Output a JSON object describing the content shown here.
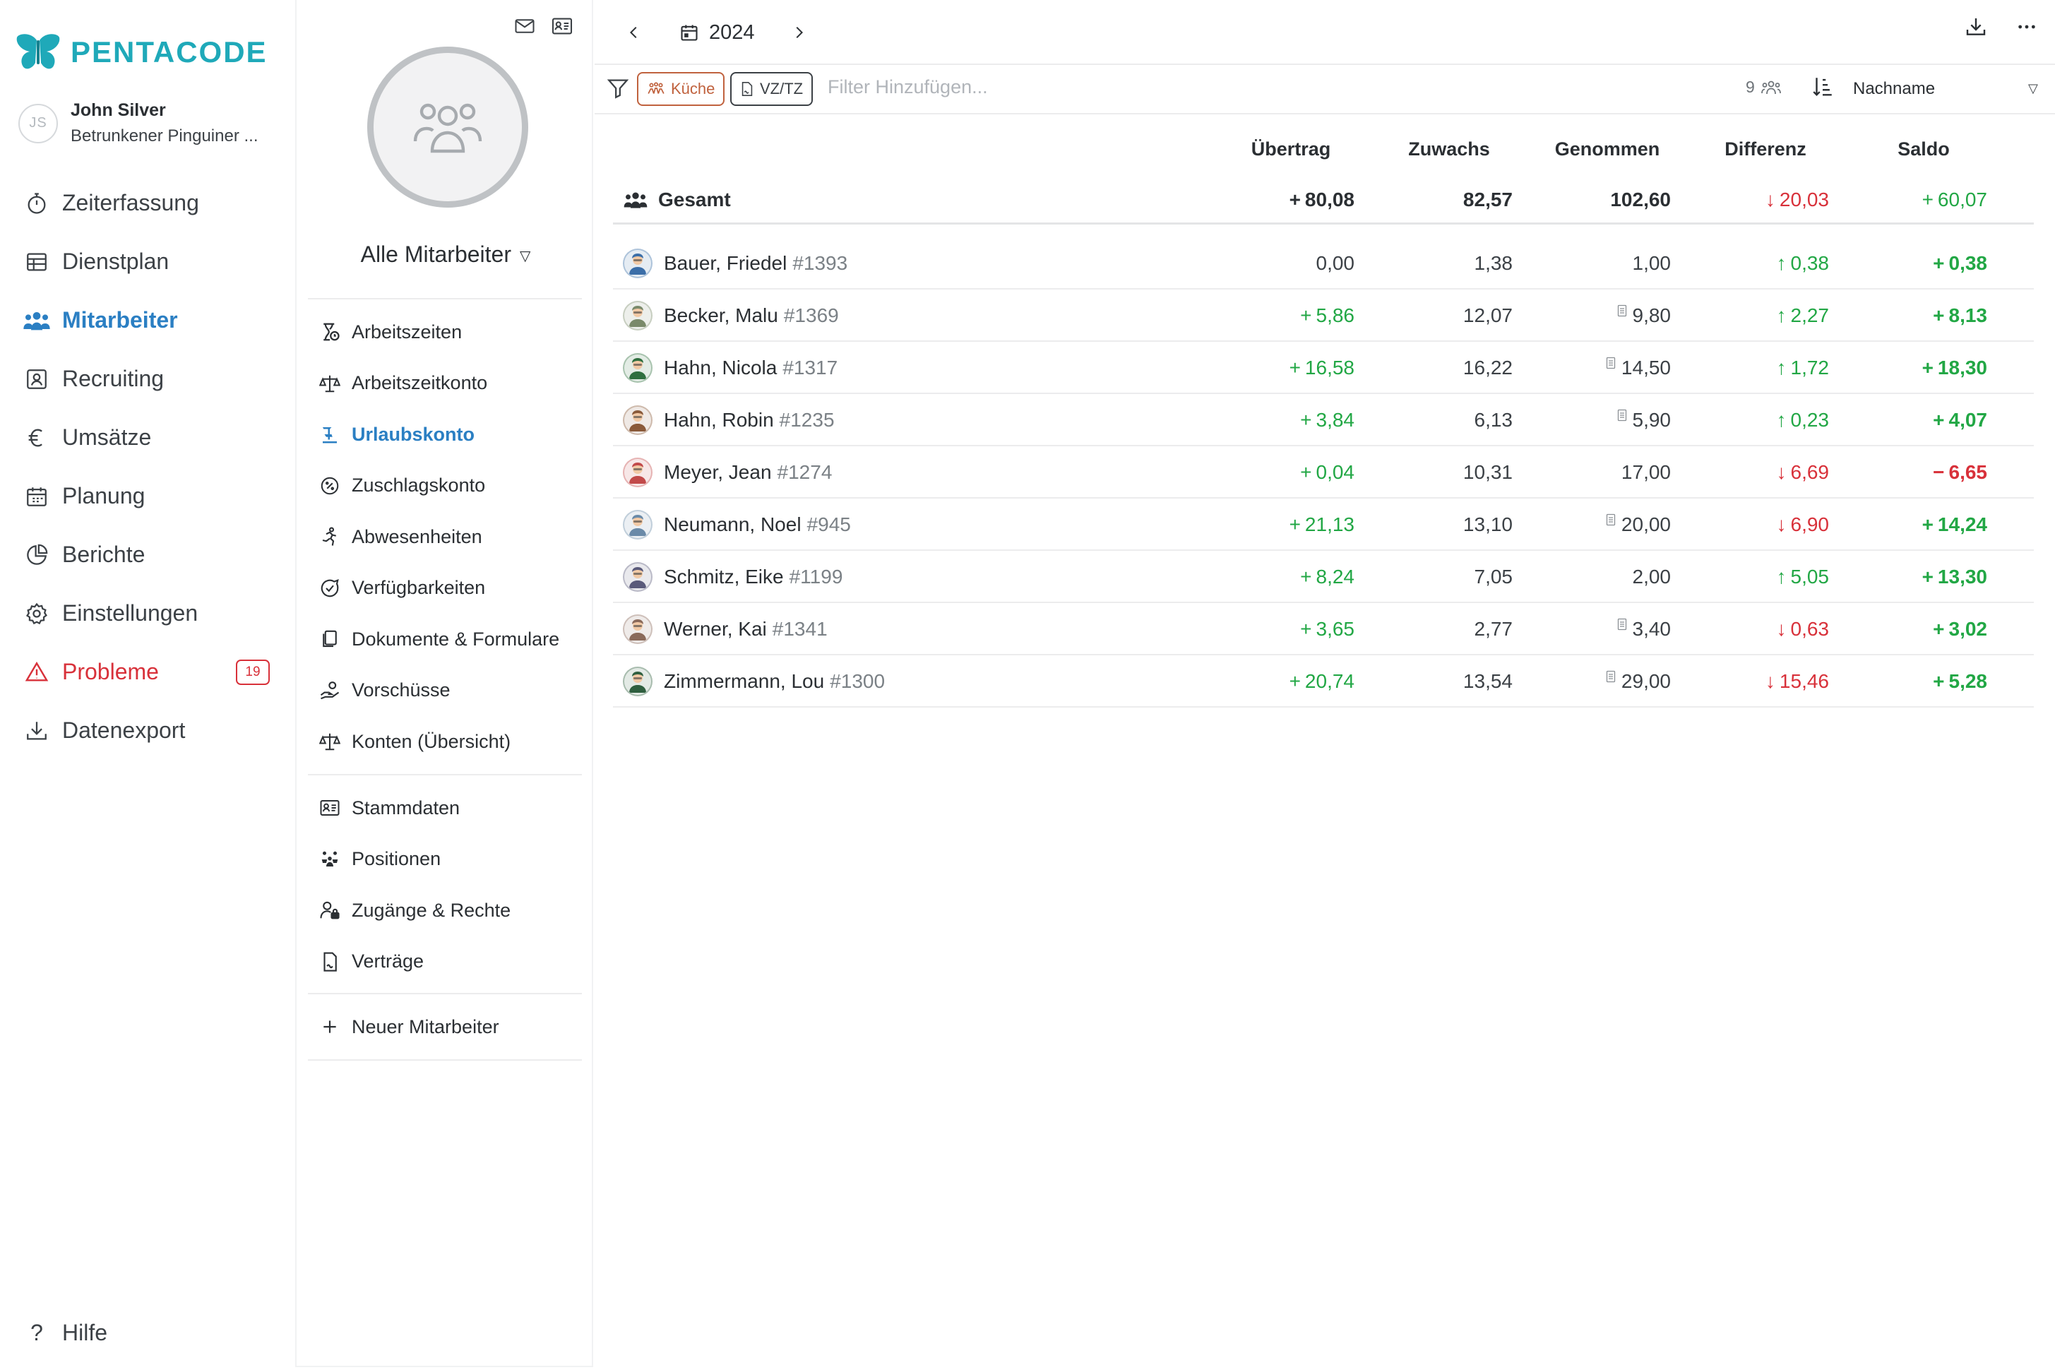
{
  "brand": {
    "name": "PENTACODE"
  },
  "user": {
    "initials": "JS",
    "name": "John Silver",
    "team": "Betrunkener Pinguiner ..."
  },
  "nav": {
    "items": [
      {
        "label": "Zeiterfassung",
        "icon": "stopwatch-icon"
      },
      {
        "label": "Dienstplan",
        "icon": "table-icon"
      },
      {
        "label": "Mitarbeiter",
        "icon": "people-icon",
        "active": true
      },
      {
        "label": "Recruiting",
        "icon": "id-card-icon"
      },
      {
        "label": "Umsätze",
        "icon": "euro-icon"
      },
      {
        "label": "Planung",
        "icon": "calendar-icon"
      },
      {
        "label": "Berichte",
        "icon": "pie-chart-icon"
      },
      {
        "label": "Einstellungen",
        "icon": "gear-icon"
      },
      {
        "label": "Probleme",
        "icon": "warning-icon",
        "badge": "19"
      },
      {
        "label": "Datenexport",
        "icon": "download-icon"
      }
    ],
    "help": "Hilfe"
  },
  "sub": {
    "group_label": "Alle Mitarbeiter",
    "items_a": [
      {
        "label": "Arbeitszeiten",
        "icon": "hourglass-icon"
      },
      {
        "label": "Arbeitszeitkonto",
        "icon": "scale-icon"
      },
      {
        "label": "Urlaubskonto",
        "icon": "beach-icon",
        "active": true
      },
      {
        "label": "Zuschlagskonto",
        "icon": "percent-badge-icon"
      },
      {
        "label": "Abwesenheiten",
        "icon": "running-icon"
      },
      {
        "label": "Verfügbarkeiten",
        "icon": "chat-check-icon"
      },
      {
        "label": "Dokumente & Formulare",
        "icon": "documents-icon"
      },
      {
        "label": "Vorschüsse",
        "icon": "hand-coin-icon"
      },
      {
        "label": "Konten (Übersicht)",
        "icon": "scale-icon"
      }
    ],
    "items_b": [
      {
        "label": "Stammdaten",
        "icon": "id-card-icon"
      },
      {
        "label": "Positionen",
        "icon": "team-icon"
      },
      {
        "label": "Zugänge & Rechte",
        "icon": "user-lock-icon"
      },
      {
        "label": "Verträge",
        "icon": "contract-icon"
      }
    ],
    "new_employee": "Neuer Mitarbeiter"
  },
  "toolbar": {
    "year": "2024"
  },
  "filter": {
    "chips": [
      {
        "label": "Küche",
        "color": "#c0623e"
      },
      {
        "label": "VZ/TZ",
        "color": "#3c4146"
      }
    ],
    "placeholder": "Filter Hinzufügen...",
    "count": "9",
    "sort_label": "Nachname"
  },
  "table": {
    "headers": [
      "Übertrag",
      "Zuwachs",
      "Genommen",
      "Differenz",
      "Saldo"
    ],
    "total": {
      "label": "Gesamt",
      "uebertrag": "80,08",
      "zuwachs": "82,57",
      "genommen": "102,60",
      "differenz": "20,03",
      "differenz_dir": "down",
      "saldo": "60,07",
      "saldo_sign": "+"
    },
    "rows": [
      {
        "name": "Bauer, Friedel",
        "num": "#1393",
        "uebertrag": "0,00",
        "uebertrag_sign": "",
        "zuwachs": "1,38",
        "genommen": "1,00",
        "doc": false,
        "differenz": "0,38",
        "differenz_dir": "up",
        "saldo": "0,38",
        "saldo_sign": "+",
        "avatar_color": "#3b6ea8"
      },
      {
        "name": "Becker, Malu",
        "num": "#1369",
        "uebertrag": "5,86",
        "uebertrag_sign": "+",
        "zuwachs": "12,07",
        "genommen": "9,80",
        "doc": true,
        "differenz": "2,27",
        "differenz_dir": "up",
        "saldo": "8,13",
        "saldo_sign": "+",
        "avatar_color": "#7a8a6a"
      },
      {
        "name": "Hahn, Nicola",
        "num": "#1317",
        "uebertrag": "16,58",
        "uebertrag_sign": "+",
        "zuwachs": "16,22",
        "genommen": "14,50",
        "doc": true,
        "differenz": "1,72",
        "differenz_dir": "up",
        "saldo": "18,30",
        "saldo_sign": "+",
        "avatar_color": "#2f6f3f"
      },
      {
        "name": "Hahn, Robin",
        "num": "#1235",
        "uebertrag": "3,84",
        "uebertrag_sign": "+",
        "zuwachs": "6,13",
        "genommen": "5,90",
        "doc": true,
        "differenz": "0,23",
        "differenz_dir": "up",
        "saldo": "4,07",
        "saldo_sign": "+",
        "avatar_color": "#8a5a3a"
      },
      {
        "name": "Meyer, Jean",
        "num": "#1274",
        "uebertrag": "0,04",
        "uebertrag_sign": "+",
        "zuwachs": "10,31",
        "genommen": "17,00",
        "doc": false,
        "differenz": "6,69",
        "differenz_dir": "down",
        "saldo": "6,65",
        "saldo_sign": "−",
        "avatar_color": "#c24a4a"
      },
      {
        "name": "Neumann, Noel",
        "num": "#945",
        "uebertrag": "21,13",
        "uebertrag_sign": "+",
        "zuwachs": "13,10",
        "genommen": "20,00",
        "doc": true,
        "differenz": "6,90",
        "differenz_dir": "down",
        "saldo": "14,24",
        "saldo_sign": "+",
        "avatar_color": "#6a8aa8"
      },
      {
        "name": "Schmitz, Eike",
        "num": "#1199",
        "uebertrag": "8,24",
        "uebertrag_sign": "+",
        "zuwachs": "7,05",
        "genommen": "2,00",
        "doc": false,
        "differenz": "5,05",
        "differenz_dir": "up",
        "saldo": "13,30",
        "saldo_sign": "+",
        "avatar_color": "#5a5a7a"
      },
      {
        "name": "Werner, Kai",
        "num": "#1341",
        "uebertrag": "3,65",
        "uebertrag_sign": "+",
        "zuwachs": "2,77",
        "genommen": "3,40",
        "doc": true,
        "differenz": "0,63",
        "differenz_dir": "down",
        "saldo": "3,02",
        "saldo_sign": "+",
        "avatar_color": "#8a6a5a"
      },
      {
        "name": "Zimmermann, Lou",
        "num": "#1300",
        "uebertrag": "20,74",
        "uebertrag_sign": "+",
        "zuwachs": "13,54",
        "genommen": "29,00",
        "doc": true,
        "differenz": "15,46",
        "differenz_dir": "down",
        "saldo": "5,28",
        "saldo_sign": "+",
        "avatar_color": "#2f5f3f"
      }
    ]
  }
}
